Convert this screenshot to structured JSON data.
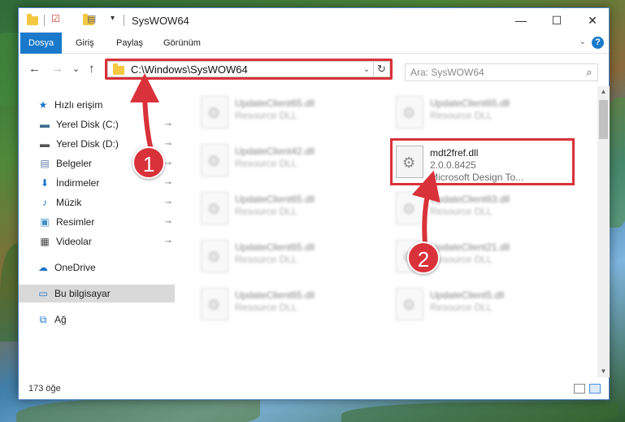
{
  "window": {
    "title": "SysWOW64",
    "controls": {
      "minimize": "—",
      "maximize": "☐",
      "close": "✕"
    }
  },
  "ribbon": {
    "tabs": [
      "Dosya",
      "Giriş",
      "Paylaş",
      "Görünüm"
    ],
    "help": "?",
    "collapse": "⌄"
  },
  "nav": {
    "back": "←",
    "forward": "→",
    "recent": "⌄",
    "up": "↑",
    "address": "C:\\Windows\\SysWOW64",
    "address_dropdown": "⌄",
    "refresh": "↻",
    "search_placeholder": "Ara: SysWOW64",
    "search_icon": "⌕"
  },
  "sidebar": {
    "items": [
      {
        "label": "Hızlı erişim",
        "icon": "star-icon",
        "glyph": "★",
        "color": "#1a73c9",
        "pinned": false
      },
      {
        "label": "Yerel Disk (C:)",
        "icon": "drive-icon",
        "glyph": "▬",
        "color": "#3c6b8f",
        "pinned": true
      },
      {
        "label": "Yerel Disk (D:)",
        "icon": "drive-icon",
        "glyph": "▬",
        "color": "#555555",
        "pinned": true
      },
      {
        "label": "Belgeler",
        "icon": "documents-icon",
        "glyph": "▤",
        "color": "#5a7fa8",
        "pinned": true
      },
      {
        "label": "İndirmeler",
        "icon": "download-icon",
        "glyph": "⬇",
        "color": "#1a73c9",
        "pinned": true
      },
      {
        "label": "Müzik",
        "icon": "music-icon",
        "glyph": "♪",
        "color": "#1a73c9",
        "pinned": true
      },
      {
        "label": "Resimler",
        "icon": "pictures-icon",
        "glyph": "▣",
        "color": "#3c8fc9",
        "pinned": true
      },
      {
        "label": "Videolar",
        "icon": "videos-icon",
        "glyph": "▦",
        "color": "#444444",
        "pinned": true
      },
      {
        "label": "OneDrive",
        "icon": "cloud-icon",
        "glyph": "☁",
        "color": "#1a73c9",
        "pinned": false
      },
      {
        "label": "Bu bilgisayar",
        "icon": "computer-icon",
        "glyph": "▭",
        "color": "#1a73c9",
        "pinned": false,
        "selected": true
      },
      {
        "label": "Ağ",
        "icon": "network-icon",
        "glyph": "⧉",
        "color": "#1a73c9",
        "pinned": false
      }
    ],
    "pin_glyph": "📌"
  },
  "files": [
    {
      "name": "UpdateClient65.dll",
      "sub": "Resource DLL",
      "blurred": true
    },
    {
      "name": "UpdateClient65.dll",
      "sub": "Resource DLL",
      "blurred": true
    },
    {
      "name": "UpdateClient42.dll",
      "sub": "Resource DLL",
      "blurred": true
    },
    {
      "name": "mdt2fref.dll",
      "version": "2.0.0.8425",
      "description": "Microsoft Design To...",
      "blurred": false,
      "highlighted": true
    },
    {
      "name": "UpdateClient65.dll",
      "sub": "Resource DLL",
      "blurred": true
    },
    {
      "name": "UpdateClient63.dll",
      "sub": "Resource DLL",
      "blurred": true
    },
    {
      "name": "UpdateClient65.dll",
      "sub": "Resource DLL",
      "blurred": true
    },
    {
      "name": "UpdateClient21.dll",
      "sub": "Resource DLL",
      "blurred": true
    },
    {
      "name": "UpdateClient65.dll",
      "sub": "Resource DLL",
      "blurred": true
    },
    {
      "name": "UpdateClient5.dll",
      "sub": "Resource DLL",
      "blurred": true
    }
  ],
  "status": {
    "count": "173 öğe"
  },
  "callouts": {
    "first": "1",
    "second": "2"
  },
  "colors": {
    "accent": "#1979ca",
    "highlight": "#d9323a"
  }
}
